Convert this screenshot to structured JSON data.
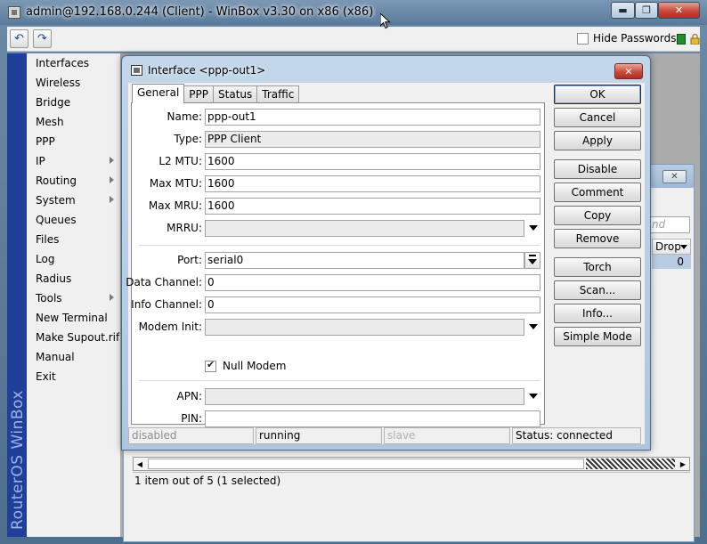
{
  "window": {
    "title": "admin@192.168.0.244 (Client) - WinBox v3.30 on x86 (x86)",
    "min_glyph": "▬",
    "max_glyph": "❐",
    "close_glyph": "✕"
  },
  "toolbar": {
    "undo_glyph": "↶",
    "redo_glyph": "↷",
    "hide_passwords_label": "Hide Passwords",
    "hide_passwords_checked": false
  },
  "sidebar": {
    "brand": "RouterOS WinBox",
    "items": [
      {
        "label": "Interfaces",
        "submenu": false
      },
      {
        "label": "Wireless",
        "submenu": false
      },
      {
        "label": "Bridge",
        "submenu": false
      },
      {
        "label": "Mesh",
        "submenu": false
      },
      {
        "label": "PPP",
        "submenu": false
      },
      {
        "label": "IP",
        "submenu": true
      },
      {
        "label": "Routing",
        "submenu": true
      },
      {
        "label": "System",
        "submenu": true
      },
      {
        "label": "Queues",
        "submenu": false
      },
      {
        "label": "Files",
        "submenu": false
      },
      {
        "label": "Log",
        "submenu": false
      },
      {
        "label": "Radius",
        "submenu": false
      },
      {
        "label": "Tools",
        "submenu": true
      },
      {
        "label": "New Terminal",
        "submenu": false
      },
      {
        "label": "Make Supout.rif",
        "submenu": false
      },
      {
        "label": "Manual",
        "submenu": false
      },
      {
        "label": "Exit",
        "submenu": false
      }
    ]
  },
  "list_window": {
    "find_placeholder": "nd",
    "column_drop": "Drop",
    "row_value": "0",
    "status_text": "1 item out of 5 (1 selected)",
    "close_glyph": "✕"
  },
  "dialog": {
    "title": "Interface <ppp-out1>",
    "close_glyph": "✕",
    "tabs": [
      "General",
      "PPP",
      "Status",
      "Traffic"
    ],
    "active_tab": "General",
    "fields": {
      "name": {
        "label": "Name:",
        "value": "ppp-out1"
      },
      "type": {
        "label": "Type:",
        "value": "PPP Client"
      },
      "l2mtu": {
        "label": "L2 MTU:",
        "value": "1600"
      },
      "max_mtu": {
        "label": "Max MTU:",
        "value": "1600"
      },
      "max_mru": {
        "label": "Max MRU:",
        "value": "1600"
      },
      "mrru": {
        "label": "MRRU:",
        "value": ""
      },
      "port": {
        "label": "Port:",
        "value": "serial0"
      },
      "data_channel": {
        "label": "Data Channel:",
        "value": "0"
      },
      "info_channel": {
        "label": "Info Channel:",
        "value": "0"
      },
      "modem_init": {
        "label": "Modem Init:",
        "value": ""
      },
      "null_modem": {
        "label": "Null Modem",
        "checked": true
      },
      "apn": {
        "label": "APN:",
        "value": ""
      },
      "pin": {
        "label": "PIN:",
        "value": ""
      }
    },
    "buttons": {
      "ok": "OK",
      "cancel": "Cancel",
      "apply": "Apply",
      "disable": "Disable",
      "comment": "Comment",
      "copy": "Copy",
      "remove": "Remove",
      "torch": "Torch",
      "scan": "Scan...",
      "info": "Info...",
      "simple_mode": "Simple Mode"
    },
    "status_bar": {
      "state": "disabled",
      "running": "running",
      "slave": "slave",
      "connection": "Status: connected"
    }
  },
  "colors": {
    "sidebar_strip": "#1f3f99",
    "sidebar_brand": "#9cb3e6",
    "status_ok": "#1d8f2c",
    "close_red": "#cb4b3c"
  }
}
